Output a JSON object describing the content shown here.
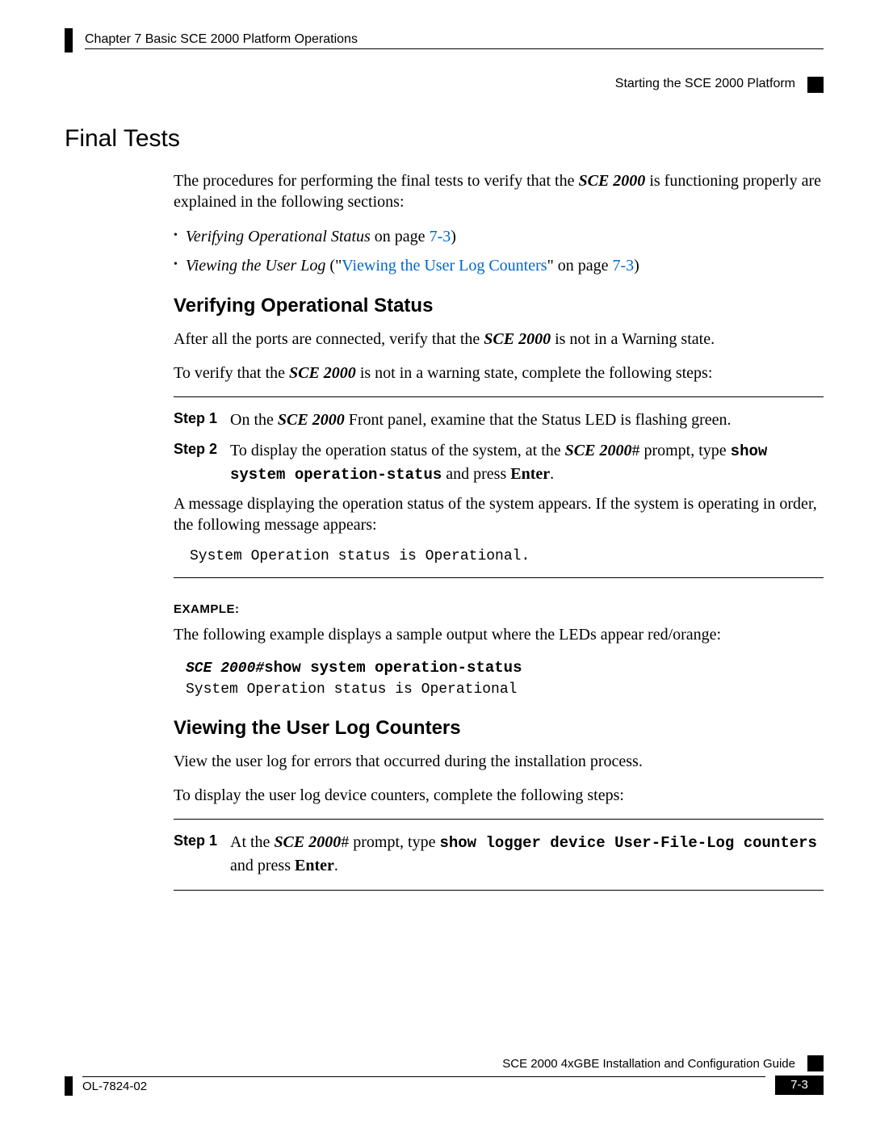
{
  "header": {
    "chapter": "Chapter 7      Basic SCE 2000 Platform Operations",
    "section": "Starting the SCE 2000 Platform"
  },
  "h1": "Final Tests",
  "intro": {
    "p1_a": "The procedures for performing the final tests to verify that the ",
    "p1_b": "SCE 2000",
    "p1_c": " is functioning properly are explained in the following sections:"
  },
  "bullets": {
    "b1_a": "Verifying Operational Status",
    "b1_b": " on page ",
    "b1_c": "7-3",
    "b1_d": ")",
    "b2_a": "Viewing the User Log",
    "b2_b": " (\"",
    "b2_c": "Viewing the User Log Counters",
    "b2_d": "\" on page ",
    "b2_e": "7-3",
    "b2_f": ")"
  },
  "sec1": {
    "title": "Verifying Operational Status",
    "p1_a": "After all the ports are connected, verify that the ",
    "p1_b": "SCE 2000",
    "p1_c": " is not in a Warning state.",
    "p2_a": "To verify that the ",
    "p2_b": "SCE 2000",
    "p2_c": " is not in a warning state, complete the following steps:",
    "step1_label": "Step 1",
    "step1_a": "On the ",
    "step1_b": "SCE 2000",
    "step1_c": " Front panel, examine that the Status LED is flashing green.",
    "step2_label": "Step 2",
    "step2_a": "To display the operation status of the system, at the ",
    "step2_b": "SCE 2000",
    "step2_c": "# prompt, type ",
    "step2_d": "show system operation-status",
    "step2_e": " and press ",
    "step2_f": "Enter",
    "step2_g": ".",
    "msg": "A message displaying the operation status of the system appears. If the system is operating in order, the following message appears:",
    "output": "System Operation status is Operational.",
    "example_label": "EXAMPLE:",
    "example_intro": "The following example displays a sample output where the LEDs appear red/orange:",
    "example_line1": "SCE 2000#",
    "example_line1b": "show system operation-status",
    "example_line2": "System Operation status is Operational"
  },
  "sec2": {
    "title": "Viewing the User Log Counters",
    "p1": "View the user log for errors that occurred during the installation process.",
    "p2": "To display the user log device counters, complete the following steps:",
    "step1_label": "Step 1",
    "step1_a": "At the ",
    "step1_b": "SCE 2000",
    "step1_c": "# prompt, type ",
    "step1_d": "show logger device User-File-Log counters",
    "step1_e": " and press ",
    "step1_f": "Enter",
    "step1_g": "."
  },
  "footer": {
    "guide": "SCE 2000 4xGBE Installation and Configuration Guide",
    "doc": "OL-7824-02",
    "page": "7-3"
  }
}
